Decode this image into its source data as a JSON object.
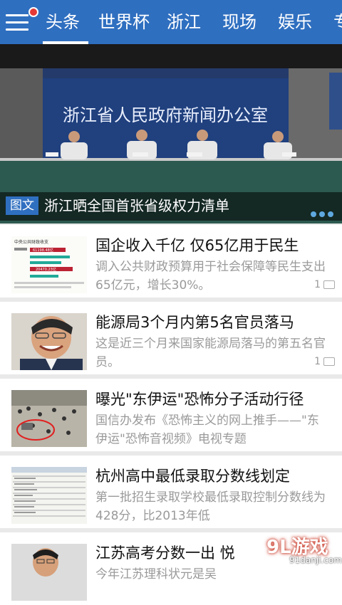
{
  "tabs": [
    {
      "label": "头条"
    },
    {
      "label": "世界杯"
    },
    {
      "label": "浙江"
    },
    {
      "label": "现场"
    },
    {
      "label": "娱乐"
    },
    {
      "label": "专"
    }
  ],
  "hero": {
    "tag": "图文",
    "title": "浙江晒全国首张省级权力清单",
    "banner_text": "浙江省人民政府新闻办公室",
    "pager_dots": 3
  },
  "news": [
    {
      "title": "国企收入千亿 仅65亿用于民生",
      "summary": "调入公共财政预算用于社会保障等民生支出65亿元，增长30%。",
      "comments": "1"
    },
    {
      "title": "能源局3个月内第5名官员落马",
      "summary": "这是近三个月来国家能源局落马的第五名官员。",
      "comments": "1"
    },
    {
      "title": "曝光\"东伊运\"恐怖分子活动行径",
      "summary": "国信办发布《恐怖主义的网上推手——\"东伊运\"恐怖音视频》电视专题",
      "comments": ""
    },
    {
      "title": "杭州高中最低录取分数线划定",
      "summary": "第一批招生录取学校最低录取控制分数线为428分，比2013年低",
      "comments": ""
    },
    {
      "title": "江苏高考分数一出 悦",
      "summary": "今年江苏理科状元是吴",
      "comments": ""
    }
  ],
  "thumb1": {
    "header": "中央公共财政收支",
    "value_a": "61198.48亿",
    "value_b": "20470.23亿"
  },
  "watermark": {
    "logo": "9L游戏",
    "url": "91danji.com"
  },
  "colors": {
    "brand": "#2f6fc0",
    "accent_red": "#e53935"
  }
}
